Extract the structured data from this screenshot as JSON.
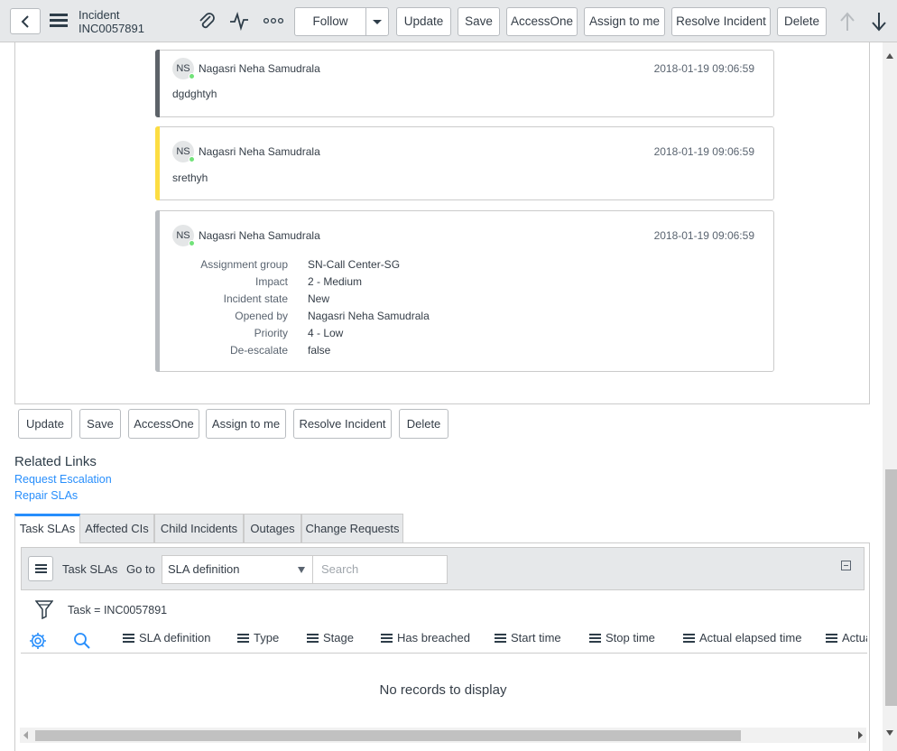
{
  "header": {
    "title": "Incident",
    "number": "INC0057891",
    "follow_label": "Follow",
    "buttons": [
      "Update",
      "Save",
      "AccessOne",
      "Assign to me",
      "Resolve Incident",
      "Delete"
    ]
  },
  "activity": [
    {
      "initials": "NS",
      "user": "Nagasri Neha Samudrala",
      "time": "2018-01-19 09:06:59",
      "text": "dgdghtyh",
      "bar_color": "#5d6369"
    },
    {
      "initials": "NS",
      "user": "Nagasri Neha Samudrala",
      "time": "2018-01-19 09:06:59",
      "text": "srethyh",
      "bar_color": "#fcdd42"
    },
    {
      "initials": "NS",
      "user": "Nagasri Neha Samudrala",
      "time": "2018-01-19 09:06:59",
      "bar_color": "#b8bcc0",
      "fields": [
        {
          "label": "Assignment group",
          "value": "SN-Call Center-SG"
        },
        {
          "label": "Impact",
          "value": "2 - Medium"
        },
        {
          "label": "Incident state",
          "value": "New"
        },
        {
          "label": "Opened by",
          "value": "Nagasri Neha Samudrala"
        },
        {
          "label": "Priority",
          "value": "4 - Low"
        },
        {
          "label": "De-escalate",
          "value": "false"
        }
      ]
    }
  ],
  "bottom_buttons": [
    "Update",
    "Save",
    "AccessOne",
    "Assign to me",
    "Resolve Incident",
    "Delete"
  ],
  "related_links": {
    "title": "Related Links",
    "links": [
      "Request Escalation",
      "Repair SLAs"
    ]
  },
  "tabs": [
    "Task SLAs",
    "Affected CIs",
    "Child Incidents",
    "Outages",
    "Change Requests"
  ],
  "list": {
    "title": "Task SLAs",
    "goto_label": "Go to",
    "select_value": "SLA definition",
    "search_placeholder": "Search",
    "filter": "Task = INC0057891",
    "columns": [
      "SLA definition",
      "Type",
      "Stage",
      "Has breached",
      "Start time",
      "Stop time",
      "Actual elapsed time",
      "Actual"
    ],
    "empty_text": "No records to display"
  },
  "colors": {
    "accent": "#278efc",
    "presence": "#71e279"
  }
}
